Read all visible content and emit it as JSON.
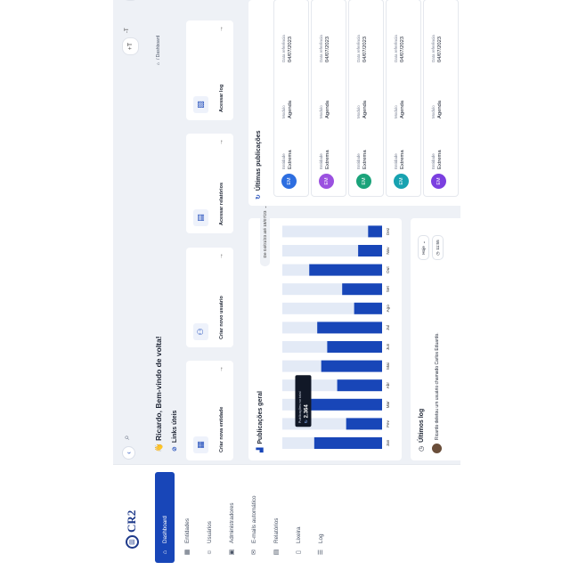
{
  "brand": {
    "logo_text": "CR2"
  },
  "sidebar": {
    "items": [
      {
        "label": "Dashboard",
        "icon": "home-icon",
        "active": true
      },
      {
        "label": "Entidades",
        "icon": "building-icon",
        "active": false
      },
      {
        "label": "Usuários",
        "icon": "users-icon",
        "active": false
      },
      {
        "label": "Administradores",
        "icon": "admin-icon",
        "active": false
      },
      {
        "label": "E-mails automático",
        "icon": "mail-icon",
        "active": false
      },
      {
        "label": "Relatórios",
        "icon": "report-icon",
        "active": false
      },
      {
        "label": "Lixeira",
        "icon": "trash-icon",
        "active": false
      },
      {
        "label": "Log",
        "icon": "log-icon",
        "active": false
      }
    ]
  },
  "topbar": {
    "collapse_icon": "chevron-left-icon",
    "font_size_large": "+T",
    "font_size_small": "-T",
    "avatar_chevron": "⌄"
  },
  "header": {
    "greeting": "Ricardo, Bem-vindo de volta!",
    "greeting_emoji": "👋",
    "breadcrumb": "/ Dashboard"
  },
  "links": {
    "title": "Links úteis",
    "items": [
      {
        "label": "Criar nova entidade",
        "icon": "building-icon"
      },
      {
        "label": "Criar novo usuário",
        "icon": "user-add-icon"
      },
      {
        "label": "Acessar relatórios",
        "icon": "report-icon"
      },
      {
        "label": "Acessar log",
        "icon": "log-icon"
      }
    ]
  },
  "chart": {
    "title": "Publicações geral",
    "filter": "De 04/01/23 até 18/07/23",
    "tooltip_label": "Publicações no total",
    "tooltip_value": "2.364"
  },
  "chart_data": {
    "type": "bar",
    "title": "Publicações geral",
    "categories": [
      "Jan",
      "Fev",
      "Mar",
      "Abr",
      "Mai",
      "Jun",
      "Jul",
      "Ago",
      "Set",
      "Out",
      "Nov",
      "Dez"
    ],
    "values": [
      68,
      36,
      71,
      45,
      61,
      55,
      65,
      28,
      40,
      73,
      24,
      14
    ],
    "max": 100,
    "highlight_category": "Mar",
    "bar_color": "#1846b8",
    "track_color": "#e3eaf6"
  },
  "publications": {
    "title": "Últimas publicações",
    "col_entidade": "Entidade",
    "col_modulo": "Modulo",
    "col_data": "Data referência",
    "items": [
      {
        "initials": "EM",
        "entidade": "Extrema",
        "modulo": "Agenda",
        "data": "04/07/2023",
        "color": "#2d6ee0"
      },
      {
        "initials": "EM",
        "entidade": "Extrema",
        "modulo": "Agenda",
        "data": "04/07/2023",
        "color": "#9b51e0"
      },
      {
        "initials": "EM",
        "entidade": "Extrema",
        "modulo": "Agenda",
        "data": "04/07/2023",
        "color": "#1aa37a"
      },
      {
        "initials": "EM",
        "entidade": "Extrema",
        "modulo": "Agenda",
        "data": "04/07/2023",
        "color": "#17a2b0"
      },
      {
        "initials": "EM",
        "entidade": "Extrema",
        "modulo": "Agenda",
        "data": "04/07/2023",
        "color": "#7b3fe0"
      }
    ]
  },
  "log": {
    "title": "Últimos log",
    "filter": "Hoje",
    "time": "11:55",
    "entry": "Ricardo deletou um usuário chamado Carlos Eduardo."
  }
}
